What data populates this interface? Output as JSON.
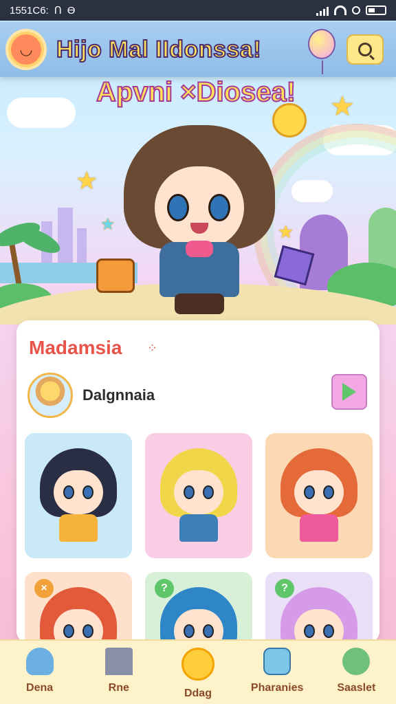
{
  "status_bar": {
    "time": "1551C6:",
    "left_extra": "Ո",
    "carrier_glyph": "Ө"
  },
  "header": {
    "app_title": "Hijo Mal IIdonssa!",
    "search_icon": "search-icon"
  },
  "hero": {
    "title": "Apvni ×Diosea!"
  },
  "section": {
    "title": "Madamsia",
    "dots": "⁘",
    "profile_name": "Dalgnnaia"
  },
  "nav": {
    "items": [
      {
        "label": "Dena",
        "icon": "bear-icon"
      },
      {
        "label": "Rne",
        "icon": "castle-icon"
      },
      {
        "label": "Ddag",
        "icon": "moon-icon"
      },
      {
        "label": "Pharanies",
        "icon": "gift-box-icon"
      },
      {
        "label": "Saaslet",
        "icon": "bowl-icon"
      }
    ]
  },
  "tiles": [
    {
      "bg": "#c9e8f8",
      "hair": "#2a2e44",
      "outfit": "#f5b33a"
    },
    {
      "bg": "#f9cde3",
      "hair": "#f2d64a",
      "outfit": "#3f7fb8"
    },
    {
      "bg": "#fbd9b4",
      "hair": "#e56a3a",
      "outfit": "#ef5a9c"
    },
    {
      "bg": "#ffe0cc",
      "hair": "#e35a3a",
      "outfit": "#5bb46a",
      "badge": "×",
      "badge_color": "#f2a13a"
    },
    {
      "bg": "#d8f0d8",
      "hair": "#2e86c8",
      "outfit": "#ef5a9c",
      "badge": "?",
      "badge_color": "#5fc66a"
    },
    {
      "bg": "#e9dff7",
      "hair": "#d69be8",
      "outfit": "#9b7ad8",
      "badge": "?",
      "badge_color": "#5fc66a"
    }
  ]
}
